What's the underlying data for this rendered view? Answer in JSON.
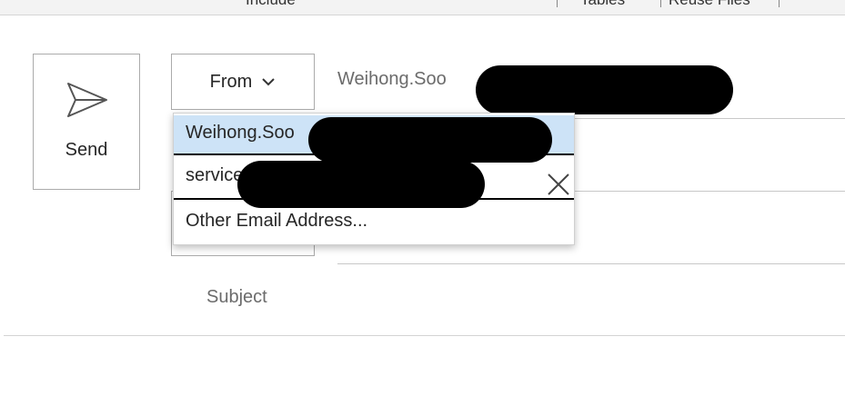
{
  "ribbon": {
    "include_label": "Include",
    "tables_label": "Tables",
    "reuse_files_label": "Reuse Files"
  },
  "send_button": {
    "label": "Send",
    "icon": "send-icon"
  },
  "from_button": {
    "label": "From",
    "icon": "chevron-down-icon"
  },
  "from_value": "Weihong.Soo",
  "dropdown": {
    "items": [
      {
        "label": "Weihong.Soo",
        "selected": true
      },
      {
        "label": "service",
        "removable": true,
        "remove_icon": "close-icon"
      },
      {
        "label": "Other Email Address..."
      }
    ]
  },
  "subject": {
    "label": "Subject"
  },
  "colors": {
    "selected_item_bg": "#cde3f7",
    "border": "#ababab",
    "muted_text": "#6b6b6b"
  }
}
